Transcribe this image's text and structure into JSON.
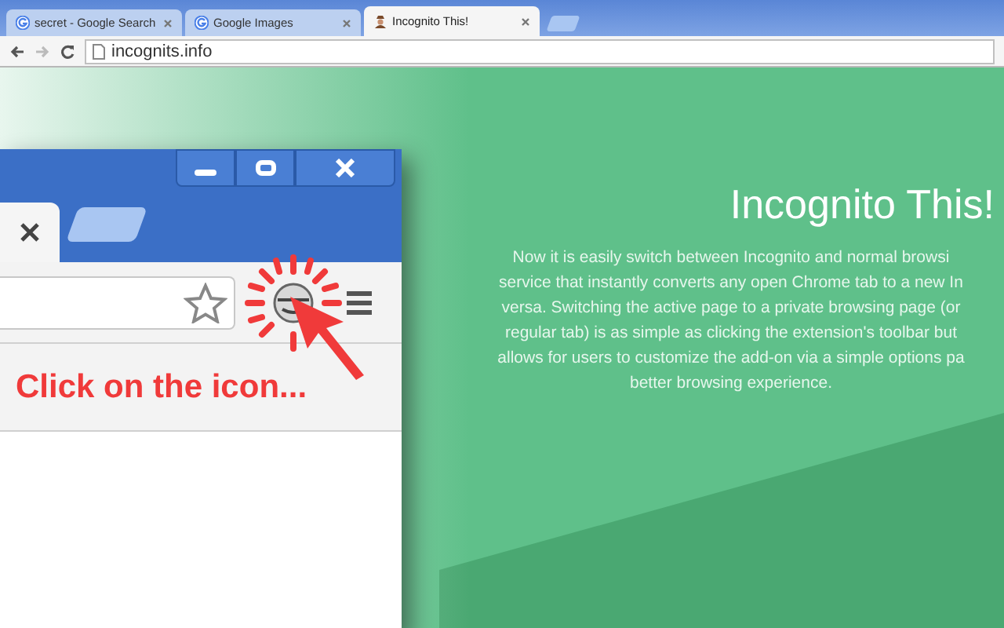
{
  "tabs": [
    {
      "title": "secret - Google Search",
      "kind": "google",
      "selected": false
    },
    {
      "title": "Google Images",
      "kind": "google",
      "selected": false
    },
    {
      "title": "Incognito This!",
      "kind": "incognito",
      "selected": true
    }
  ],
  "address": "incognits.info",
  "page": {
    "illustration": {
      "caption": "Click on the icon..."
    },
    "heading": "Incognito This!",
    "description_lines": [
      "Now it is easily switch between Incognito and normal browsi",
      "service that instantly converts any open Chrome tab to a new In",
      "versa. Switching the active page to a private browsing page (or",
      "regular tab) is as simple as clicking the extension's toolbar but",
      "allows for users to customize the add-on via a simple options pa",
      "better browsing experience."
    ]
  }
}
